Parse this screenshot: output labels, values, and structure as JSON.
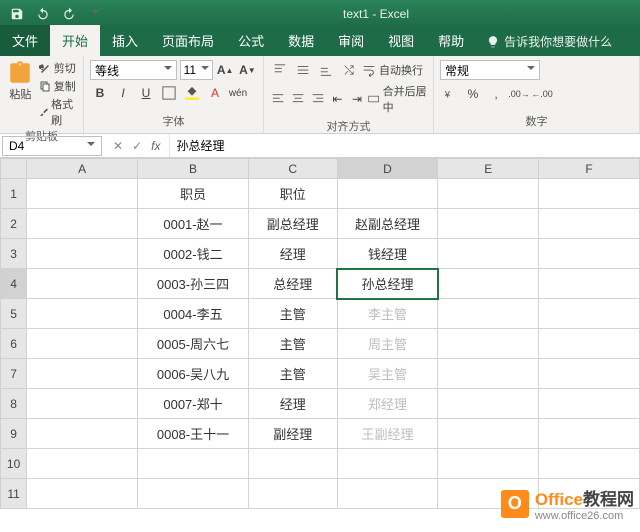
{
  "titlebar": {
    "doc_title": "text1 - Excel"
  },
  "tabs": {
    "file": "文件",
    "home": "开始",
    "insert": "插入",
    "layout": "页面布局",
    "formulas": "公式",
    "data": "数据",
    "review": "审阅",
    "view": "视图",
    "help": "帮助",
    "tellme": "告诉我你想要做什么"
  },
  "ribbon": {
    "clipboard": {
      "paste": "粘贴",
      "cut": "剪切",
      "copy": "复制",
      "painter": "格式刷",
      "label": "剪贴板"
    },
    "font": {
      "name": "等线",
      "size": "11",
      "label": "字体"
    },
    "align": {
      "wrap": "自动换行",
      "merge": "合并后居中",
      "label": "对齐方式"
    },
    "number": {
      "format": "常规",
      "label": "数字"
    }
  },
  "formula_bar": {
    "cell_ref": "D4",
    "formula": "孙总经理"
  },
  "columns": [
    "A",
    "B",
    "C",
    "D",
    "E",
    "F"
  ],
  "rows": [
    "1",
    "2",
    "3",
    "4",
    "5",
    "6",
    "7",
    "8",
    "9",
    "10",
    "11"
  ],
  "data": {
    "B1": "职员",
    "C1": "职位",
    "B2": "0001-赵一",
    "C2": "副总经理",
    "D2": "赵副总经理",
    "B3": "0002-钱二",
    "C3": "经理",
    "D3": "钱经理",
    "B4": "0003-孙三四",
    "C4": "总经理",
    "D4": "孙总经理",
    "B5": "0004-李五",
    "C5": "主管",
    "D5": "李主管",
    "B6": "0005-周六七",
    "C6": "主管",
    "D6": "周主管",
    "B7": "0006-吴八九",
    "C7": "主管",
    "D7": "吴主管",
    "B8": "0007-郑十",
    "C8": "经理",
    "D8": "郑经理",
    "B9": "0008-王十一",
    "C9": "副经理",
    "D9": "王副经理"
  },
  "watermark": {
    "brand1": "Office",
    "brand2": "教程网",
    "url": "www.office26.com"
  }
}
